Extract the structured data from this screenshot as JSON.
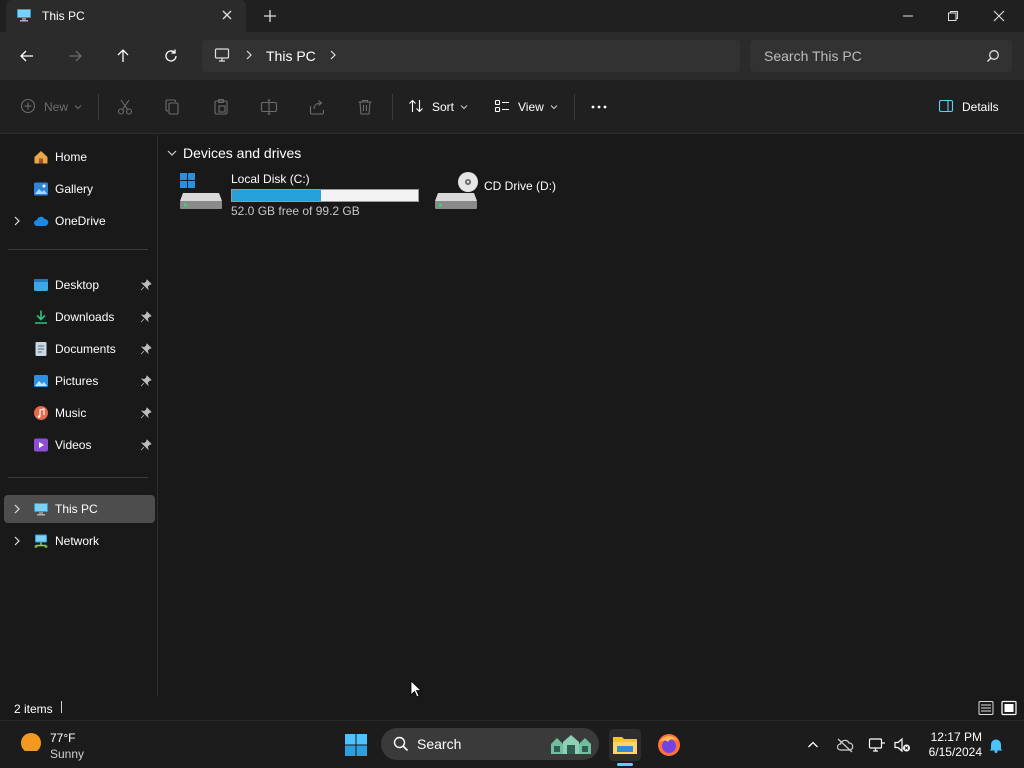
{
  "window": {
    "tab_title": "This PC",
    "icons": {
      "tab": "pc-icon",
      "close": "close-icon",
      "new_tab": "plus-icon",
      "minimize": "minimize-icon",
      "restore": "restore-icon",
      "close_window": "close-icon"
    }
  },
  "address_bar": {
    "breadcrumb": [
      "This PC"
    ],
    "search_placeholder": "Search This PC"
  },
  "command_bar": {
    "new_label": "New",
    "sort_label": "Sort",
    "view_label": "View",
    "details_label": "Details",
    "disabled_actions": [
      "cut-icon",
      "copy-icon",
      "paste-icon",
      "rename-icon",
      "share-icon",
      "delete-icon"
    ]
  },
  "sidebar": {
    "items": [
      {
        "label": "Home",
        "icon": "home-icon",
        "expandable": false
      },
      {
        "label": "Gallery",
        "icon": "gallery-icon",
        "expandable": false
      },
      {
        "label": "OneDrive",
        "icon": "cloud-icon",
        "expandable": true
      },
      {
        "label": "Desktop",
        "icon": "desktop-icon",
        "pinned": true
      },
      {
        "label": "Downloads",
        "icon": "download-icon",
        "pinned": true
      },
      {
        "label": "Documents",
        "icon": "document-icon",
        "pinned": true
      },
      {
        "label": "Pictures",
        "icon": "pictures-icon",
        "pinned": true
      },
      {
        "label": "Music",
        "icon": "music-icon",
        "pinned": true
      },
      {
        "label": "Videos",
        "icon": "video-icon",
        "pinned": true
      },
      {
        "label": "This PC",
        "icon": "pc-icon",
        "expandable": true,
        "selected": true
      },
      {
        "label": "Network",
        "icon": "network-icon",
        "expandable": true
      }
    ]
  },
  "content": {
    "group_title": "Devices and drives",
    "drives": [
      {
        "name": "Local Disk (C:)",
        "free_text": "52.0 GB free of 99.2 GB",
        "used_fraction": 0.476,
        "icon": "hard-drive-icon"
      },
      {
        "name": "CD Drive (D:)",
        "icon": "cd-drive-icon"
      }
    ]
  },
  "status_bar": {
    "item_count": "2 items"
  },
  "taskbar": {
    "weather_temp": "77°F",
    "weather_condition": "Sunny",
    "search_label": "Search",
    "time": "12:17 PM",
    "date": "6/15/2024"
  },
  "colors": {
    "accent": "#26a0da",
    "selection": "#4d4d4d",
    "background": "#191919"
  }
}
